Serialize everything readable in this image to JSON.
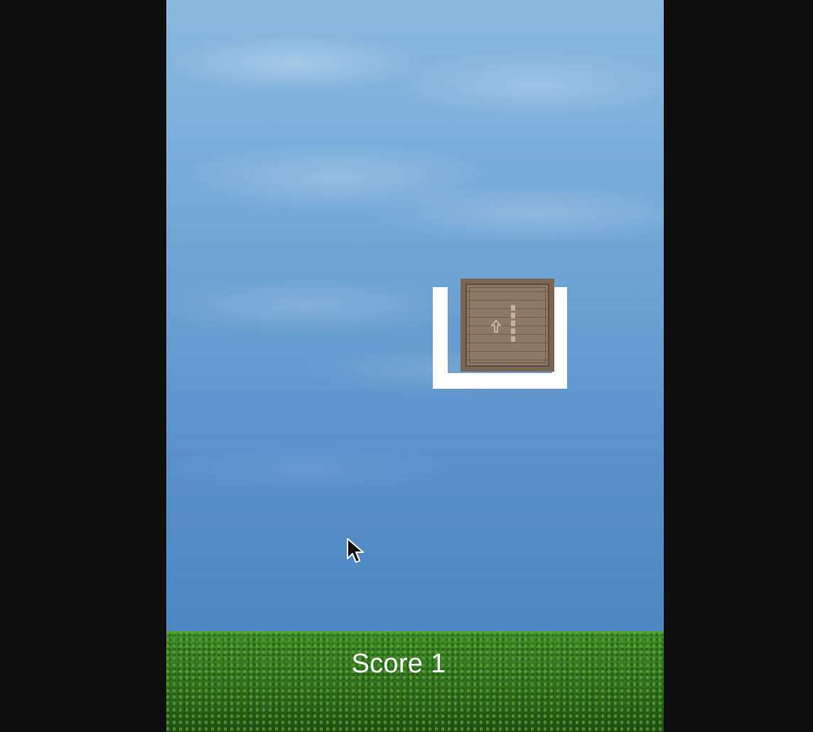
{
  "game": {
    "score_text": "Score 1",
    "score_value": 1
  },
  "objects": {
    "crate": "wooden-crate",
    "holder": "white-u-holder"
  },
  "colors": {
    "outer_background": "#0e0e0f",
    "sky_top": "#8ab9de",
    "sky_bottom": "#4d86c2",
    "grass": "#357c22",
    "holder": "#ffffff",
    "crate": "#8e7866",
    "score_text": "#ffffff"
  },
  "icons": {
    "cursor": "mouse-pointer-icon",
    "crate_arrow": "arrow-up-icon"
  }
}
